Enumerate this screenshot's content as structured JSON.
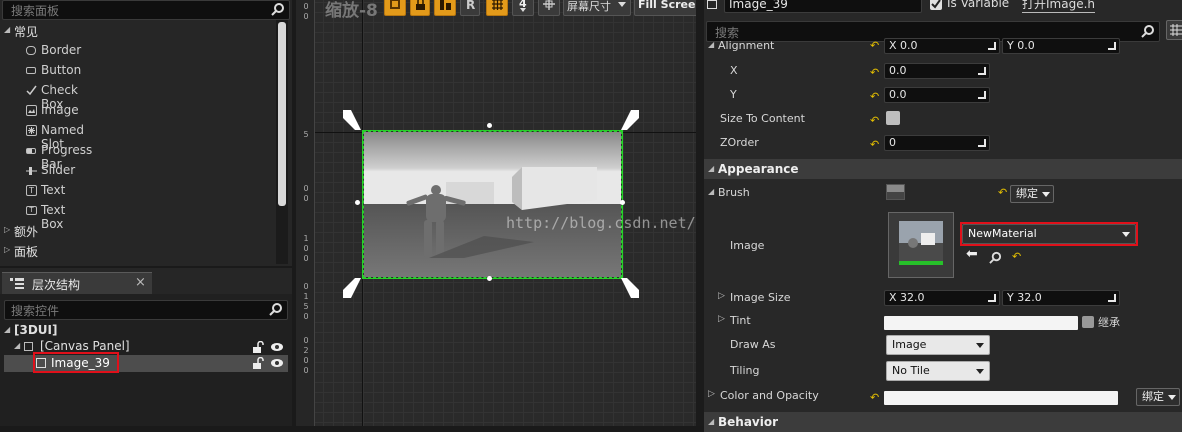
{
  "palette": {
    "search_placeholder": "搜索面板",
    "categories": [
      {
        "label": "常见",
        "expanded": true
      },
      {
        "label": "额外",
        "expanded": false
      },
      {
        "label": "面板",
        "expanded": false
      }
    ],
    "widgets": [
      "Border",
      "Button",
      "Check Box",
      "Image",
      "Named Slot",
      "Progress Bar",
      "Slider",
      "Text",
      "Text Box"
    ]
  },
  "hierarchy": {
    "tab_label": "层次结构",
    "close_label": "×",
    "search_placeholder": "搜索控件",
    "root": "[3DUI]",
    "canvas_panel": "[Canvas Panel]",
    "selected_item": "Image_39"
  },
  "designer": {
    "zoom_label": "缩放-8",
    "toolbar_r": "R",
    "toolbar_4": "4",
    "screen_size_label": "屏幕尺寸",
    "fill_screen_label": "Fill Screen",
    "ruler_ticks": [
      "0",
      "0",
      "5",
      "0",
      "0",
      "1",
      "0",
      "0",
      "0",
      "1",
      "5",
      "0",
      "0",
      "2",
      "0",
      "0",
      "0"
    ],
    "watermark": "http://blog.csdn.net/0nafio0"
  },
  "details": {
    "name_value": "Image_39",
    "is_variable_label": "Is Variable",
    "is_variable_checked": true,
    "open_link": "打开Image.h",
    "search_placeholder": "搜索",
    "alignment": {
      "label": "Alignment",
      "x": "0.0",
      "y": "0.0"
    },
    "x_row": {
      "label": "X",
      "value": "0.0"
    },
    "y_row": {
      "label": "Y",
      "value": "0.0"
    },
    "size_to_content": {
      "label": "Size To Content",
      "checked": false
    },
    "zorder": {
      "label": "ZOrder",
      "value": "0"
    },
    "appearance_label": "Appearance",
    "brush_label": "Brush",
    "bind_label": "绑定",
    "image_label": "Image",
    "material_value": "NewMaterial",
    "image_size": {
      "label": "Image Size",
      "x": "32.0",
      "y": "32.0"
    },
    "tint_label": "Tint",
    "inherit_label": "继承",
    "draw_as": {
      "label": "Draw As",
      "value": "Image"
    },
    "tiling": {
      "label": "Tiling",
      "value": "No Tile"
    },
    "color_opacity_label": "Color and Opacity",
    "behavior_label": "Behavior",
    "axis_x": "X",
    "axis_y": "Y"
  },
  "colors": {
    "selection_green": "#27d12a",
    "highlight_red": "#e0101a",
    "toolbar_orange": "#e39a1a"
  }
}
